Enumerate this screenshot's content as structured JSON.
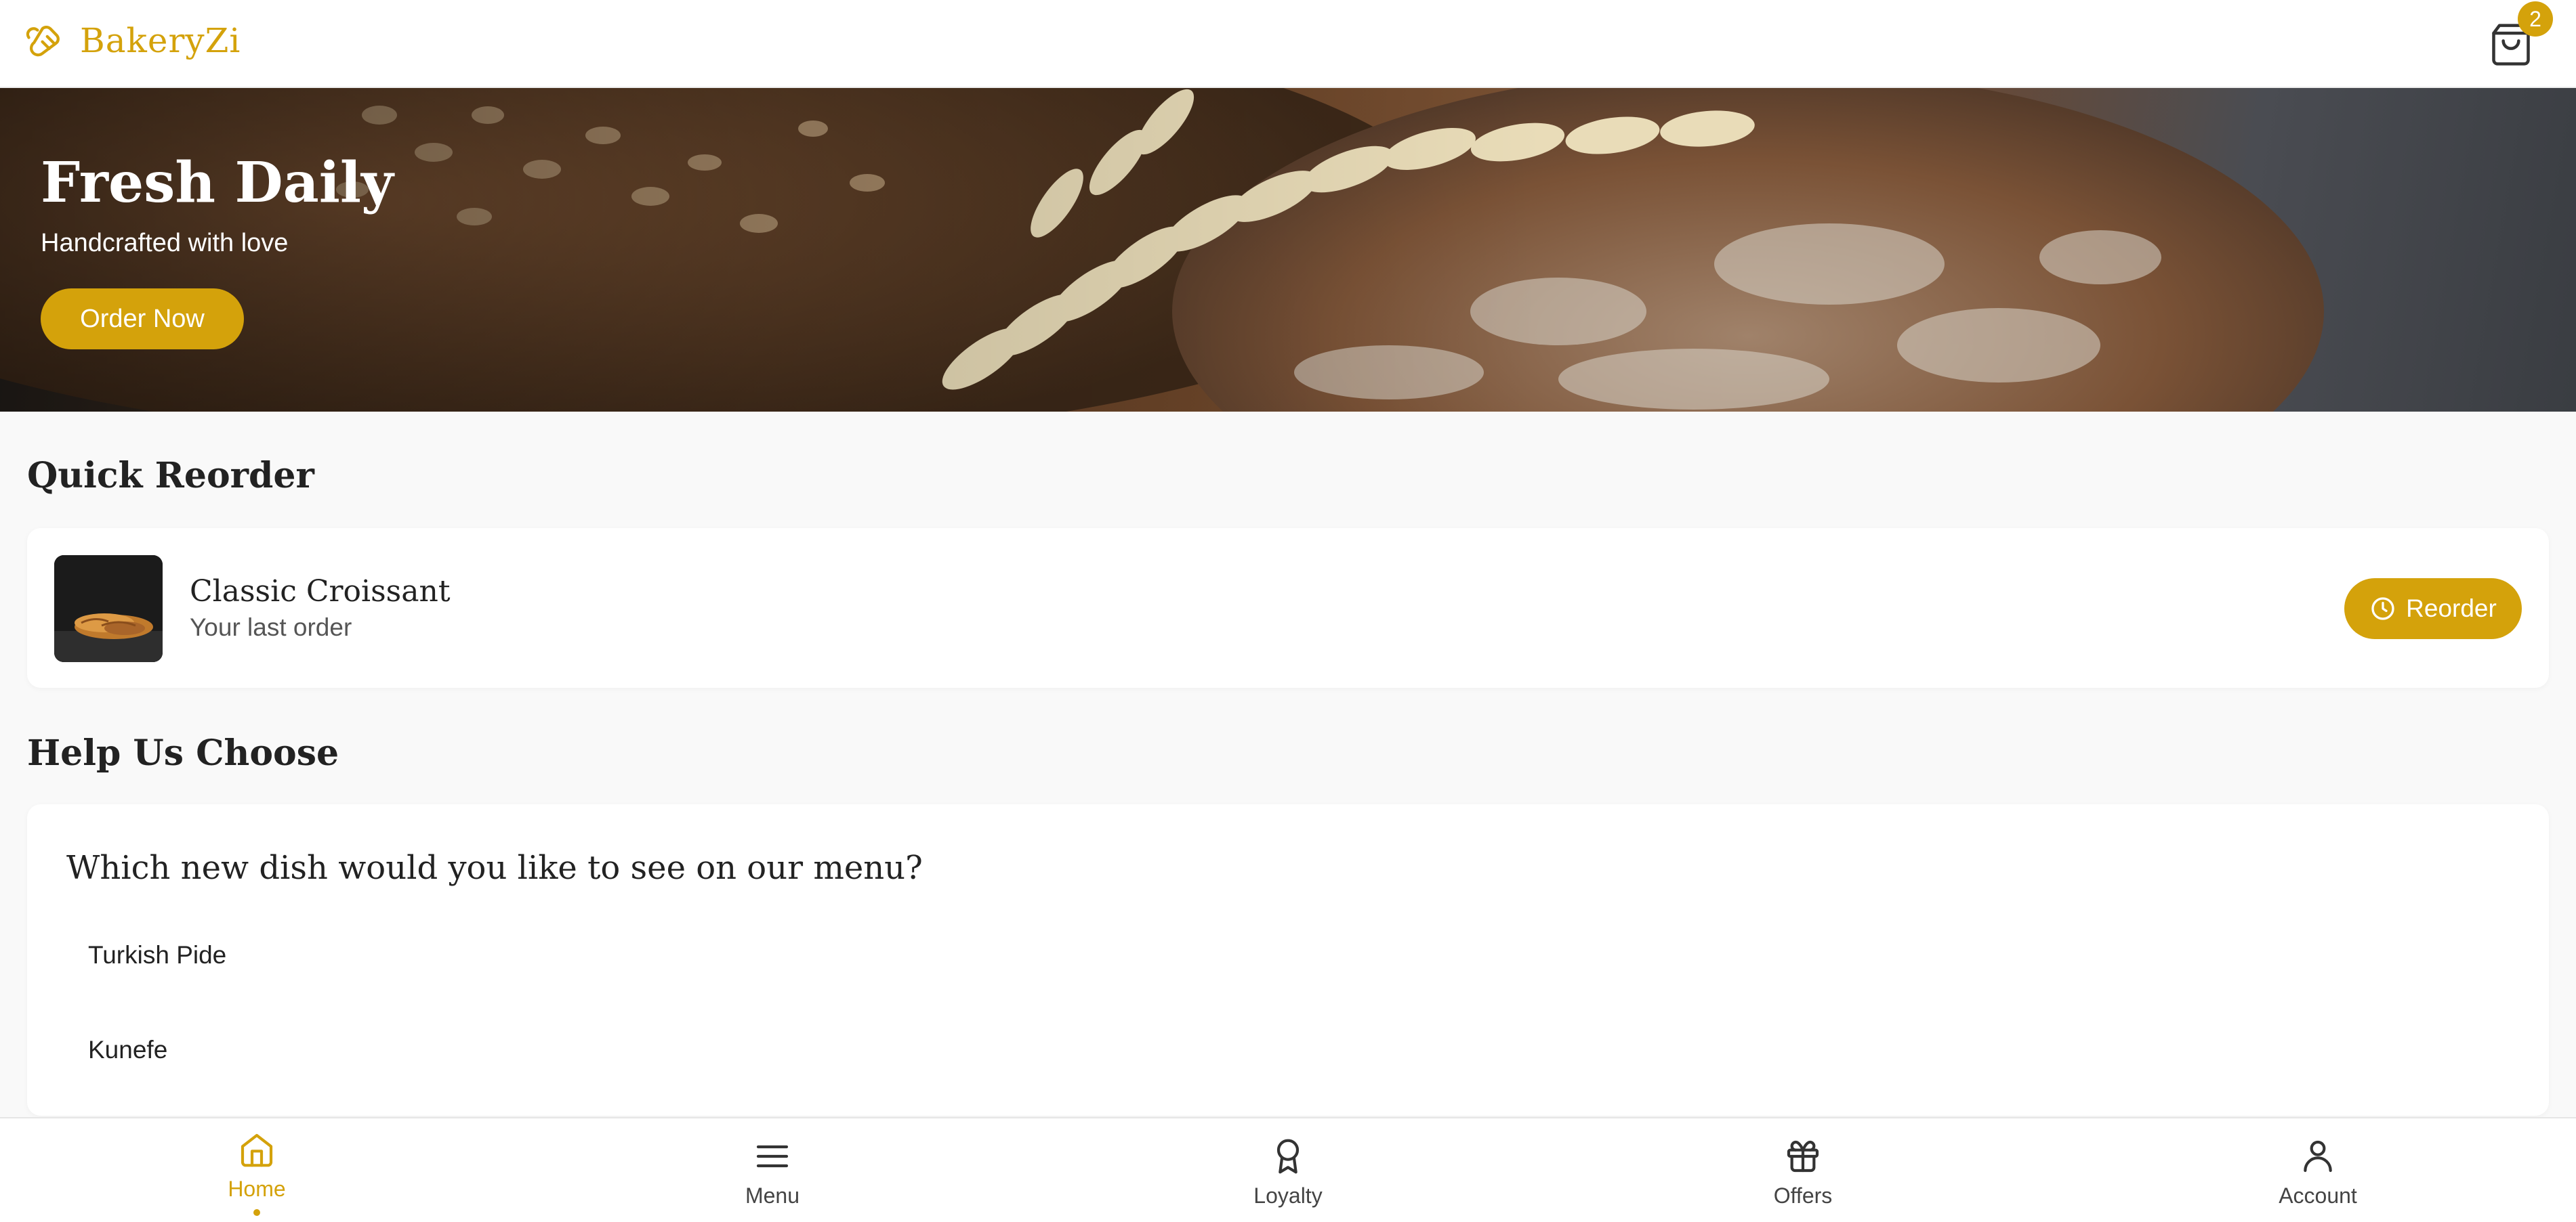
{
  "app": {
    "brand_name": "BakeryZi",
    "accent_color": "#d4a20b"
  },
  "header": {
    "cart_icon": "shopping-bag-icon",
    "cart_count": "2"
  },
  "hero": {
    "title": "Fresh Daily",
    "subtitle": "Handcrafted with love",
    "cta_label": "Order Now"
  },
  "quick_reorder": {
    "section_title": "Quick Reorder",
    "item_name": "Classic Croissant",
    "item_subtitle": "Your last order",
    "button_label": "Reorder",
    "button_icon": "clock-icon"
  },
  "poll": {
    "section_title": "Help Us Choose",
    "question": "Which new dish would you like to see on our menu?",
    "options": [
      "Turkish Pide",
      "Kunefe"
    ]
  },
  "bottom_nav": {
    "active": "Home",
    "items": [
      {
        "label": "Home",
        "icon": "home-icon"
      },
      {
        "label": "Menu",
        "icon": "menu-icon"
      },
      {
        "label": "Loyalty",
        "icon": "award-icon"
      },
      {
        "label": "Offers",
        "icon": "gift-icon"
      },
      {
        "label": "Account",
        "icon": "user-icon"
      }
    ]
  }
}
